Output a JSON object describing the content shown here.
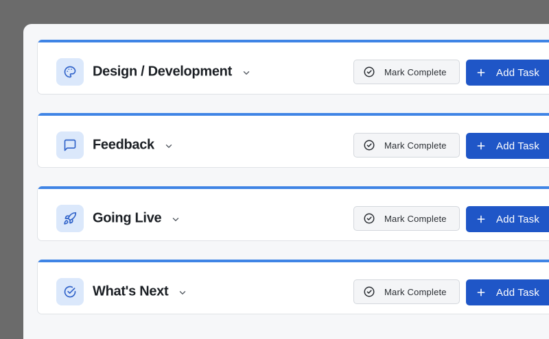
{
  "phases": [
    {
      "title": "Design / Development",
      "icon": "palette-icon",
      "mark_complete_label": "Mark Complete",
      "add_task_label": "Add Task"
    },
    {
      "title": "Feedback",
      "icon": "message-square-icon",
      "mark_complete_label": "Mark Complete",
      "add_task_label": "Add Task"
    },
    {
      "title": "Going Live",
      "icon": "rocket-icon",
      "mark_complete_label": "Mark Complete",
      "add_task_label": "Add Task"
    },
    {
      "title": "What's Next",
      "icon": "circle-check-icon",
      "mark_complete_label": "Mark Complete",
      "add_task_label": "Add Task"
    }
  ],
  "colors": {
    "accent": "#3f84e5",
    "primary_button": "#1f56c7",
    "icon_tile": "#dbe8fb"
  }
}
